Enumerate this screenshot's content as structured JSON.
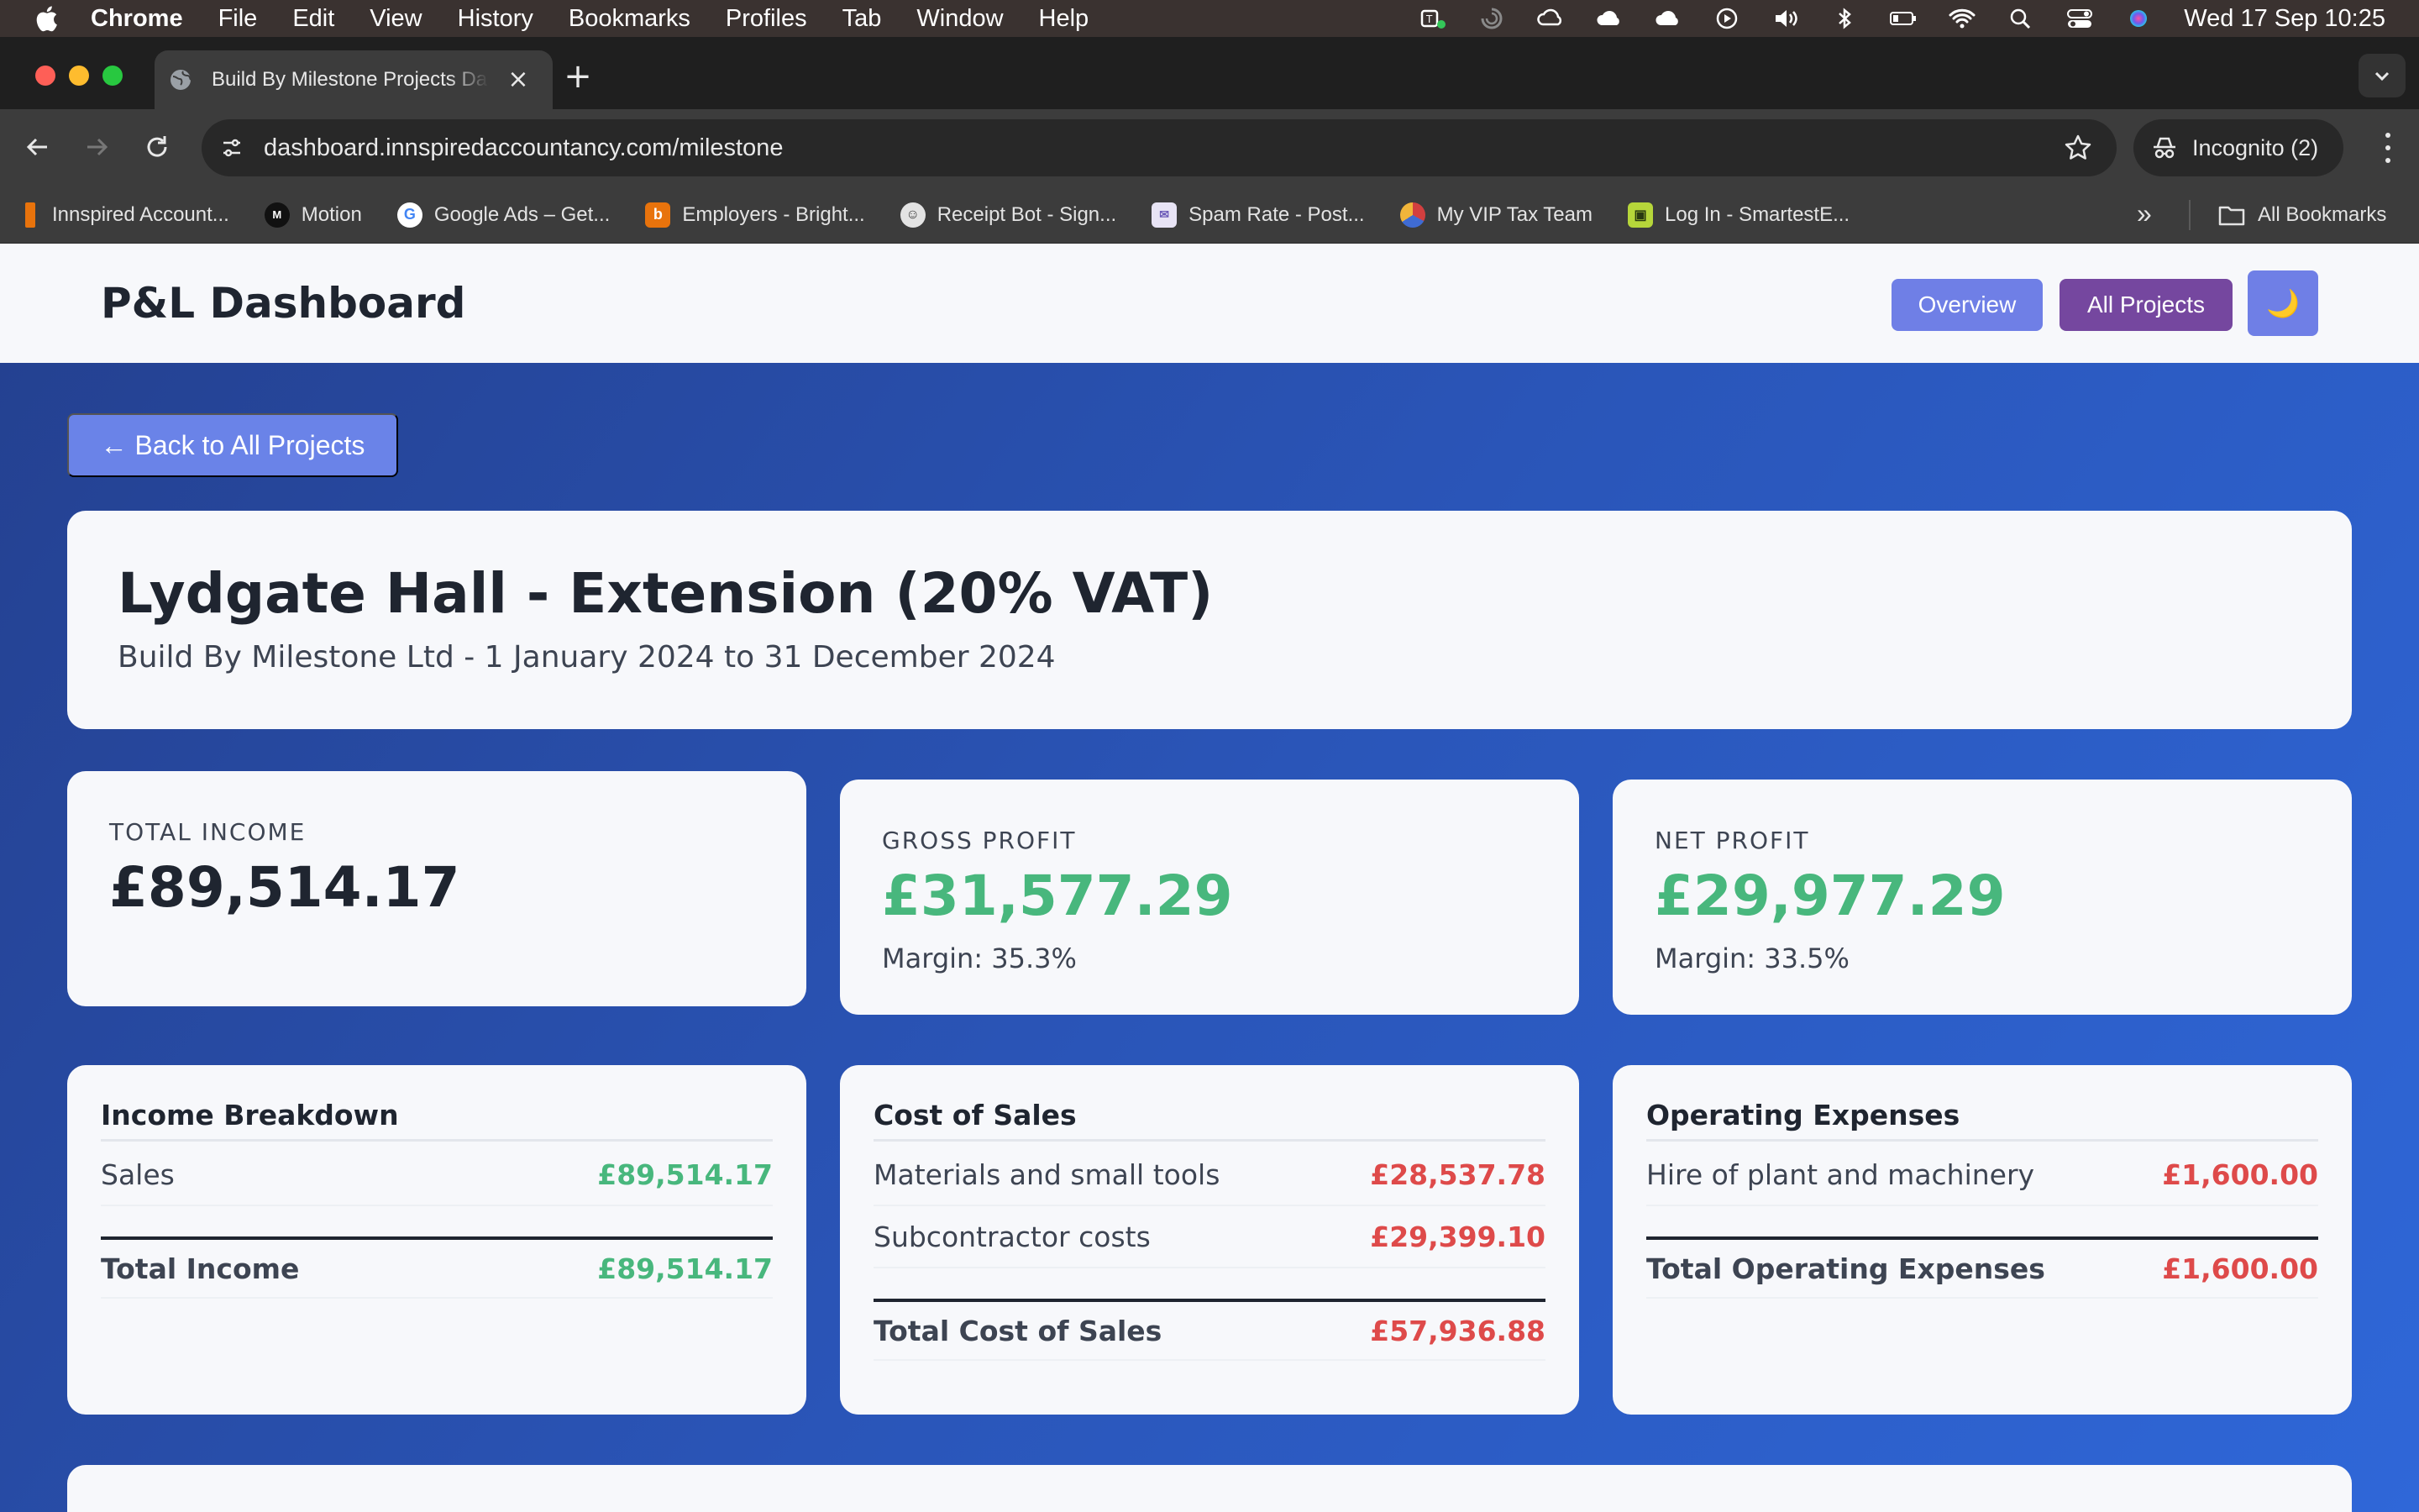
{
  "menubar": {
    "app_name": "Chrome",
    "menus": [
      "File",
      "Edit",
      "View",
      "History",
      "Bookmarks",
      "Profiles",
      "Tab",
      "Window",
      "Help"
    ],
    "clock": "Wed 17 Sep  10:25"
  },
  "browser": {
    "tab_title": "Build By Milestone Projects Dashboard",
    "url": "dashboard.innspiredaccountancy.com/milestone",
    "incognito_label": "Incognito (2)",
    "bookmarks": [
      {
        "label": "Innspired Account...",
        "icon": "innspired-favicon",
        "color": "#e8730c"
      },
      {
        "label": "Motion",
        "icon": "motion-favicon",
        "color": "#111111"
      },
      {
        "label": "Google Ads – Get...",
        "icon": "google-favicon",
        "color": "#4285f4"
      },
      {
        "label": "Employers - Bright...",
        "icon": "brighthr-favicon",
        "color": "#e8730c"
      },
      {
        "label": "Receipt Bot - Sign...",
        "icon": "receiptbot-favicon",
        "color": "#ffffff"
      },
      {
        "label": "Spam Rate - Post...",
        "icon": "postmaster-favicon",
        "color": "#6b5ab8"
      },
      {
        "label": "My VIP Tax Team",
        "icon": "viptax-favicon",
        "color": "#d23f3f"
      },
      {
        "label": "Log In - SmartestE...",
        "icon": "smartest-favicon",
        "color": "#b6d63a"
      }
    ],
    "all_bookmarks_label": "All Bookmarks"
  },
  "header": {
    "title": "P&L Dashboard",
    "overview_label": "Overview",
    "all_projects_label": "All Projects",
    "theme_icon": "🌙"
  },
  "back_label": "← Back to All Projects",
  "project": {
    "title": "Lydgate Hall - Extension (20% VAT)",
    "subtitle": "Build By Milestone Ltd - 1 January 2024 to 31 December 2024"
  },
  "kpis": {
    "total_income": {
      "label": "TOTAL INCOME",
      "value": "£89,514.17"
    },
    "gross_profit": {
      "label": "GROSS PROFIT",
      "value": "£31,577.29",
      "margin": "Margin: 35.3%"
    },
    "net_profit": {
      "label": "NET PROFIT",
      "value": "£29,977.29",
      "margin": "Margin: 33.5%"
    }
  },
  "income": {
    "title": "Income Breakdown",
    "rows": [
      {
        "label": "Sales",
        "amount": "£89,514.17"
      }
    ],
    "total": {
      "label": "Total Income",
      "amount": "£89,514.17"
    }
  },
  "cost_of_sales": {
    "title": "Cost of Sales",
    "rows": [
      {
        "label": "Materials and small tools",
        "amount": "£28,537.78"
      },
      {
        "label": "Subcontractor costs",
        "amount": "£29,399.10"
      }
    ],
    "total": {
      "label": "Total Cost of Sales",
      "amount": "£57,936.88"
    }
  },
  "operating_expenses": {
    "title": "Operating Expenses",
    "rows": [
      {
        "label": "Hire of plant and machinery",
        "amount": "£1,600.00"
      }
    ],
    "total": {
      "label": "Total Operating Expenses",
      "amount": "£1,600.00"
    }
  },
  "colors": {
    "accent": "#6f7fe6",
    "projects_button": "#75479f",
    "positive": "#48b77d",
    "negative": "#de4a4a",
    "page_gradient_start": "#24408f",
    "page_gradient_end": "#2f67d8"
  }
}
